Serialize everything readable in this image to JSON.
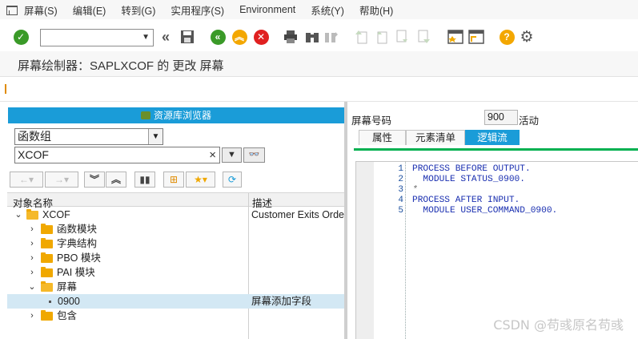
{
  "menubar": {
    "items": [
      "屏幕(S)",
      "编辑(E)",
      "转到(G)",
      "实用程序(S)",
      "Environment",
      "系统(Y)",
      "帮助(H)"
    ]
  },
  "toolbar": {
    "command_value": ""
  },
  "title": "屏幕绘制器：SAPLXCOF 的 更改 屏幕",
  "repository_browser": {
    "header": "资源库浏览器",
    "object_type": "函数组",
    "object_name": "XCOF",
    "clear_symbol": "×",
    "columns": {
      "name": "对象名称",
      "desc": "描述"
    },
    "tree": {
      "root": {
        "label": "XCOF",
        "desc": "Customer Exits Order"
      },
      "items": [
        {
          "label": "函数模块",
          "desc": ""
        },
        {
          "label": "字典结构",
          "desc": ""
        },
        {
          "label": "PBO 模块",
          "desc": ""
        },
        {
          "label": "PAI 模块",
          "desc": ""
        },
        {
          "label": "屏幕",
          "desc": ""
        },
        {
          "label": "0900",
          "desc": "屏幕添加字段"
        },
        {
          "label": "包含",
          "desc": ""
        }
      ]
    }
  },
  "screen": {
    "label": "屏幕号码",
    "number": "900",
    "status": "活动",
    "tabs": [
      "属性",
      "元素清单",
      "逻辑流"
    ],
    "active_tab": "逻辑流"
  },
  "editor": {
    "lines": [
      {
        "no": "1",
        "text": "PROCESS BEFORE OUTPUT."
      },
      {
        "no": "2",
        "text": "  MODULE STATUS_0900."
      },
      {
        "no": "3",
        "text": "*"
      },
      {
        "no": "4",
        "text": "PROCESS AFTER INPUT."
      },
      {
        "no": "5",
        "text": "  MODULE USER_COMMAND_0900."
      }
    ]
  },
  "watermark": "CSDN @苟彧原名苟彧",
  "colors": {
    "accent": "#1a9cd8",
    "tab_underline": "#00b050",
    "folder": "#f0a800"
  }
}
